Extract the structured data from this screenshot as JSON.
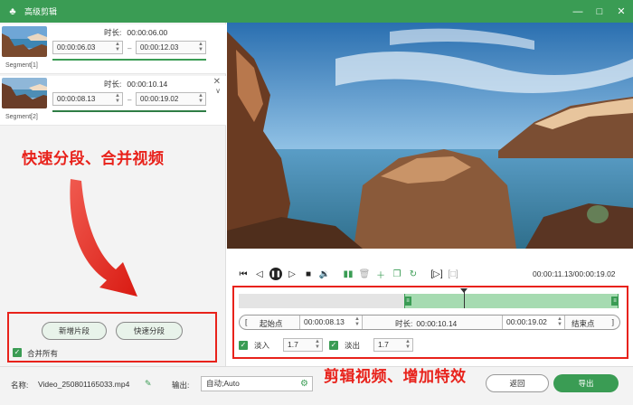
{
  "window": {
    "title": "高级剪辑",
    "app_icon": "bunny-logo-icon",
    "controls": [
      "minimize-icon",
      "maximize-icon",
      "close-icon"
    ]
  },
  "segments": [
    {
      "label": "Segment[1]",
      "duration_label": "时长:",
      "duration": "00:00:06.00",
      "start": "00:00:06.03",
      "end": "00:00:12.03"
    },
    {
      "label": "Segment[2]",
      "duration_label": "时长:",
      "duration": "00:00:10.14",
      "start": "00:00:08.13",
      "end": "00:00:19.02"
    }
  ],
  "annotations": {
    "left": "快速分段、合并视频",
    "right": "剪辑视频、增加特效"
  },
  "left_actions": {
    "add_segment": "新增片段",
    "quick_split": "快速分段",
    "merge_all": "合并所有",
    "merge_all_checked": true
  },
  "player": {
    "timecode": "00:00:11.13/00:00:19.02",
    "buttons": [
      "skip-to-start-icon",
      "step-back-icon",
      "pause-icon",
      "step-forward-icon",
      "stop-icon",
      "volume-icon",
      "split-icon",
      "delete-icon",
      "add-icon",
      "copy-icon",
      "refresh-icon",
      "mark-in-icon",
      "mark-out-icon"
    ]
  },
  "timeline": {
    "selection_start_fraction": 0.436,
    "cursor_fraction": 0.593
  },
  "trim": {
    "start_label": "起始点",
    "start_value": "00:00:08.13",
    "duration_label": "时长:",
    "duration_value": "00:00:10.14",
    "end_value": "00:00:19.02",
    "end_label": "结束点",
    "bracket_open": "[",
    "bracket_close": "]"
  },
  "effects": {
    "fade_in_label": "淡入",
    "fade_in_value": "1.7",
    "fade_in_checked": true,
    "fade_out_label": "淡出",
    "fade_out_value": "1.7",
    "fade_out_checked": true
  },
  "footer": {
    "name_label": "名称:",
    "name_value": "Video_250801165033.mp4",
    "output_label": "输出:",
    "output_value": "自动;Auto",
    "back_button": "返回",
    "export_button": "导出"
  },
  "colors": {
    "brand_green": "#3a9c54",
    "annotation_red": "#e8221b"
  }
}
